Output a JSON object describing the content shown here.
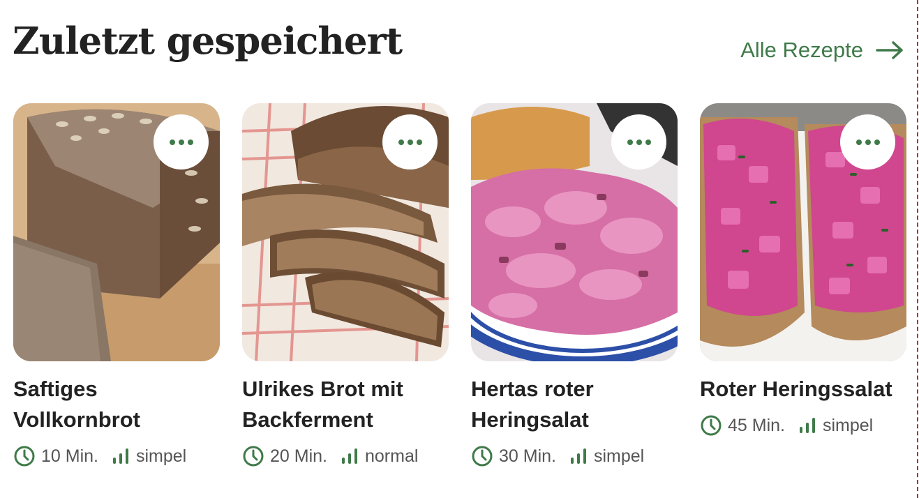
{
  "header": {
    "title": "Zuletzt gespeichert",
    "all_link": "Alle Rezepte"
  },
  "colors": {
    "accent": "#3f7a49",
    "border_dash": "#c62828"
  },
  "icons": {
    "more": "more-dots-icon",
    "time": "clock-icon",
    "difficulty": "difficulty-bars-icon",
    "arrow": "arrow-right-icon"
  },
  "cards": [
    {
      "title": "Saftiges Vollkornbrot",
      "time": "10 Min.",
      "difficulty": "simpel"
    },
    {
      "title": "Ulrikes Brot mit Backferment",
      "time": "20 Min.",
      "difficulty": "normal"
    },
    {
      "title": "Hertas roter Heringsalat",
      "time": "30 Min.",
      "difficulty": "simpel"
    },
    {
      "title": "Roter Heringssalat",
      "time": "45 Min.",
      "difficulty": "simpel"
    }
  ]
}
